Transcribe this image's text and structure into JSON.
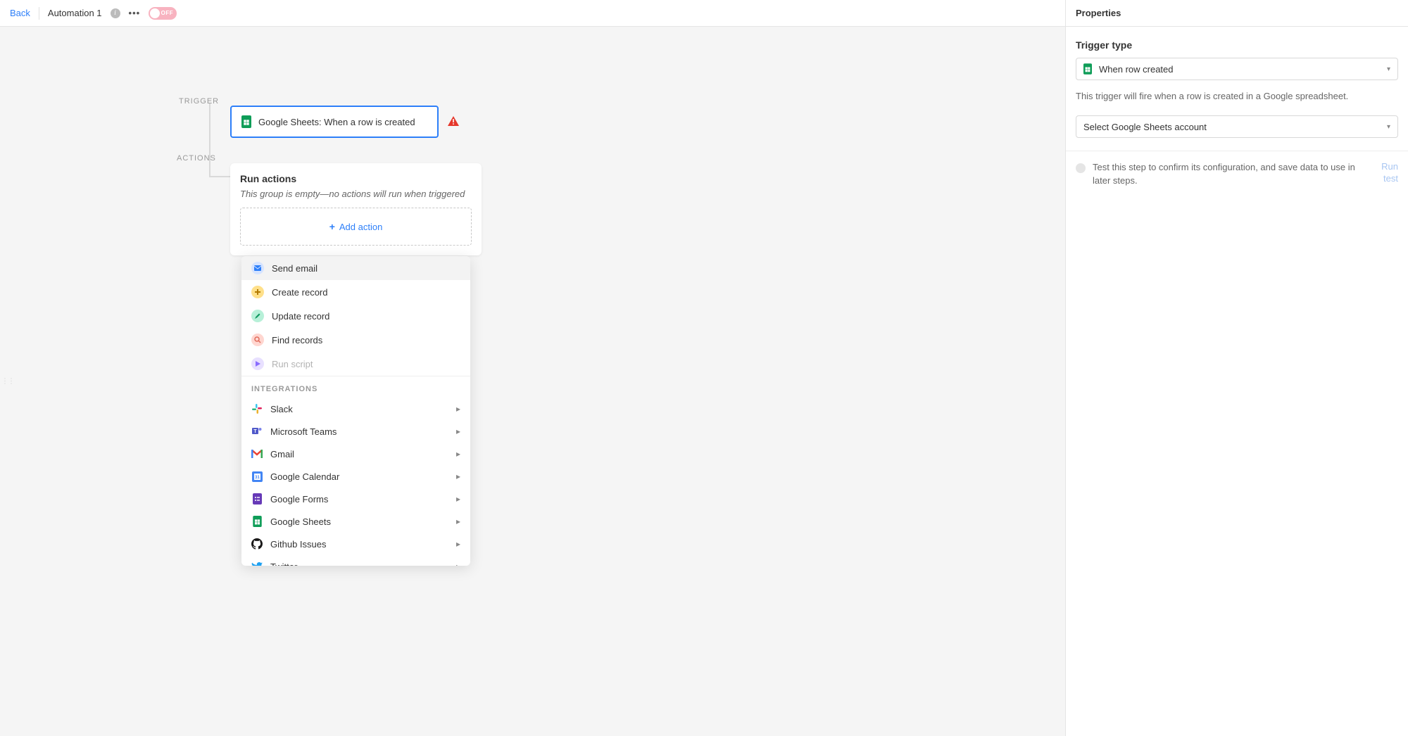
{
  "topbar": {
    "back": "Back",
    "automation_name": "Automation 1",
    "toggle_label": "OFF"
  },
  "canvas": {
    "trigger_label": "TRIGGER",
    "actions_label": "ACTIONS",
    "trigger_title": "Google Sheets: When a row is created",
    "run_actions_title": "Run actions",
    "run_actions_empty": "This group is empty—no actions will run when triggered",
    "add_action_label": "Add action"
  },
  "action_menu": {
    "items": [
      {
        "label": "Send email",
        "icon": "mail",
        "bg": "#d6e4ff",
        "fg": "#2d7ff9",
        "highlight": true,
        "disabled": false
      },
      {
        "label": "Create record",
        "icon": "plus",
        "bg": "#ffe08a",
        "fg": "#b37a00",
        "highlight": false,
        "disabled": false
      },
      {
        "label": "Update record",
        "icon": "pencil",
        "bg": "#b7f0d8",
        "fg": "#0f9960",
        "highlight": false,
        "disabled": false
      },
      {
        "label": "Find records",
        "icon": "search",
        "bg": "#ffd6d0",
        "fg": "#e06a5a",
        "highlight": false,
        "disabled": false
      },
      {
        "label": "Run script",
        "icon": "play",
        "bg": "#e8e0ff",
        "fg": "#8a6cff",
        "highlight": false,
        "disabled": true
      }
    ],
    "integrations_header": "INTEGRATIONS",
    "integrations": [
      {
        "label": "Slack",
        "icon": "slack"
      },
      {
        "label": "Microsoft Teams",
        "icon": "teams"
      },
      {
        "label": "Gmail",
        "icon": "gmail"
      },
      {
        "label": "Google Calendar",
        "icon": "gcal"
      },
      {
        "label": "Google Forms",
        "icon": "gforms"
      },
      {
        "label": "Google Sheets",
        "icon": "gsheets"
      },
      {
        "label": "Github Issues",
        "icon": "github"
      },
      {
        "label": "Twitter",
        "icon": "twitter"
      }
    ]
  },
  "panel": {
    "header": "Properties",
    "trigger_type_label": "Trigger type",
    "trigger_type_value": "When row created",
    "trigger_help": "This trigger will fire when a row is created in a Google spreadsheet.",
    "account_select": "Select Google Sheets account",
    "test_step_text": "Test this step to confirm its configuration, and save data to use in later steps.",
    "run_test_label": "Run test"
  }
}
